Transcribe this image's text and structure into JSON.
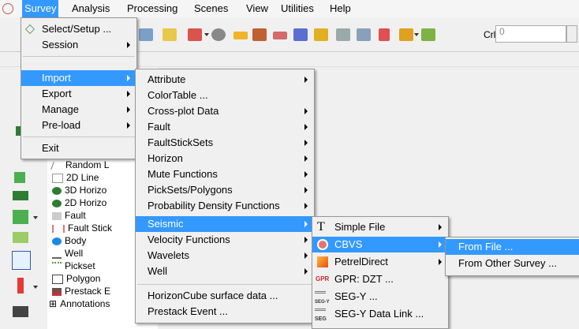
{
  "menubar": {
    "items": [
      "Survey",
      "Analysis",
      "Processing",
      "Scenes",
      "View",
      "Utilities",
      "Help"
    ],
    "active": "Survey"
  },
  "toolbar": {
    "crl_label": "Crl",
    "crl_value": "0"
  },
  "survey_menu": {
    "items": [
      {
        "label": "Select/Setup ...",
        "submenu": false
      },
      {
        "label": "Session",
        "submenu": true
      },
      {
        "label": "Import",
        "submenu": true
      },
      {
        "label": "Export",
        "submenu": true
      },
      {
        "label": "Manage",
        "submenu": true
      },
      {
        "label": "Pre-load",
        "submenu": true
      },
      {
        "label": "Exit",
        "submenu": false
      }
    ],
    "highlighted": "Import"
  },
  "import_menu": {
    "items": [
      {
        "label": "Attribute",
        "submenu": true
      },
      {
        "label": "ColorTable ...",
        "submenu": false
      },
      {
        "label": "Cross-plot Data",
        "submenu": true
      },
      {
        "label": "Fault",
        "submenu": true
      },
      {
        "label": "FaultStickSets",
        "submenu": true
      },
      {
        "label": "Horizon",
        "submenu": true
      },
      {
        "label": "Mute Functions",
        "submenu": true
      },
      {
        "label": "PickSets/Polygons",
        "submenu": true
      },
      {
        "label": "Probability Density Functions",
        "submenu": true
      },
      {
        "label": "Seismic",
        "submenu": true
      },
      {
        "label": "Velocity Functions",
        "submenu": true
      },
      {
        "label": "Wavelets",
        "submenu": true
      },
      {
        "label": "Well",
        "submenu": true
      },
      {
        "label": "HorizonCube surface data ...",
        "submenu": false
      },
      {
        "label": "Prestack Event ...",
        "submenu": false
      }
    ],
    "highlighted": "Seismic"
  },
  "seismic_menu": {
    "items": [
      {
        "label": "Simple File",
        "submenu": true,
        "icon": "text-t-icon"
      },
      {
        "label": "CBVS",
        "submenu": true,
        "icon": "cbvs-disk-icon"
      },
      {
        "label": "PetrelDirect",
        "submenu": true,
        "icon": "petrel-icon"
      },
      {
        "label": "GPR: DZT ...",
        "submenu": false,
        "icon": "gpr-icon",
        "icon_text": "GPR"
      },
      {
        "label": "SEG-Y ...",
        "submenu": false,
        "icon": "segy-icon",
        "icon_text": "SEG-Y"
      },
      {
        "label": "SEG-Y Data Link ...",
        "submenu": false,
        "icon": "segy-link-icon",
        "icon_text": "SEG"
      }
    ],
    "highlighted": "CBVS"
  },
  "cbvs_menu": {
    "items": [
      {
        "label": "From File ..."
      },
      {
        "label": "From Other Survey ..."
      }
    ],
    "highlighted": "From File ..."
  },
  "tree": {
    "items": [
      "Random L",
      "2D Line",
      "3D Horizo",
      "2D Horizo",
      "Fault",
      "Fault Stick",
      "Body",
      "Well",
      "Pickset",
      "Polygon",
      "Prestack E",
      "Annotations"
    ],
    "expander": "⊞"
  },
  "colors": {
    "highlight": "#3399ff",
    "menu_bg": "#f0f0f0"
  }
}
